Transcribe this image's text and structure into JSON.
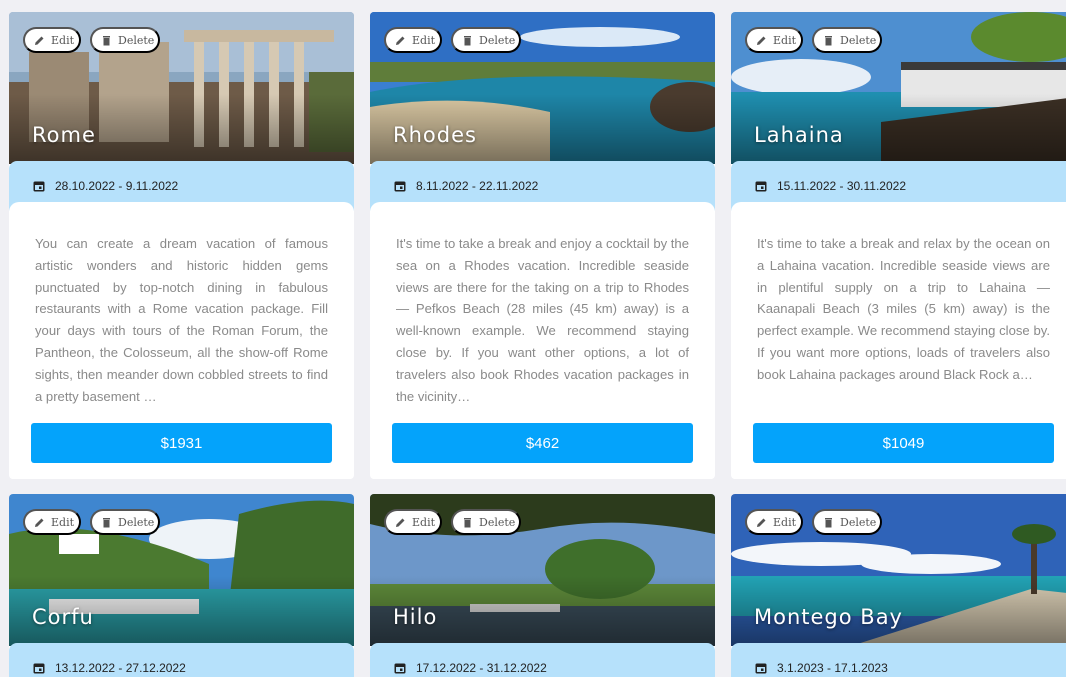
{
  "actions": {
    "edit_label": "Edit",
    "delete_label": "Delete"
  },
  "cards": [
    {
      "city": "Rome",
      "dates": "28.10.2022 - 9.11.2022",
      "description": "You can create a dream vacation of famous artistic wonders and historic hidden gems punctuated by top-notch dining in fabulous restaurants with a Rome vacation package. Fill your days with tours of the Roman Forum, the Pantheon, the Colosseum, all the show-off Rome sights, then meander down cobbled streets to find a pretty basement …",
      "price": "$1931"
    },
    {
      "city": "Rhodes",
      "dates": "8.11.2022 - 22.11.2022",
      "description": "It's time to take a break and enjoy a cocktail by the sea on a Rhodes vacation. Incredible seaside views are there for the taking on a trip to Rhodes — Pefkos Beach (28 miles (45 km) away) is a well-known example. We recommend staying close by. If you want other options, a lot of travelers also book Rhodes vacation packages in the vicinity…",
      "price": "$462"
    },
    {
      "city": "Lahaina",
      "dates": "15.11.2022 - 30.11.2022",
      "description": "It's time to take a break and relax by the ocean on a Lahaina vacation. Incredible seaside views are in plentiful supply on a trip to Lahaina — Kaanapali Beach (3 miles (5 km) away) is the perfect example. We recommend staying close by. If you want more options, loads of travelers also book Lahaina packages around Black Rock a…",
      "price": "$1049"
    },
    {
      "city": "Corfu",
      "dates": "13.12.2022 - 27.12.2022"
    },
    {
      "city": "Hilo",
      "dates": "17.12.2022 - 31.12.2022"
    },
    {
      "city": "Montego Bay",
      "dates": "3.1.2023 - 17.1.2023"
    }
  ]
}
